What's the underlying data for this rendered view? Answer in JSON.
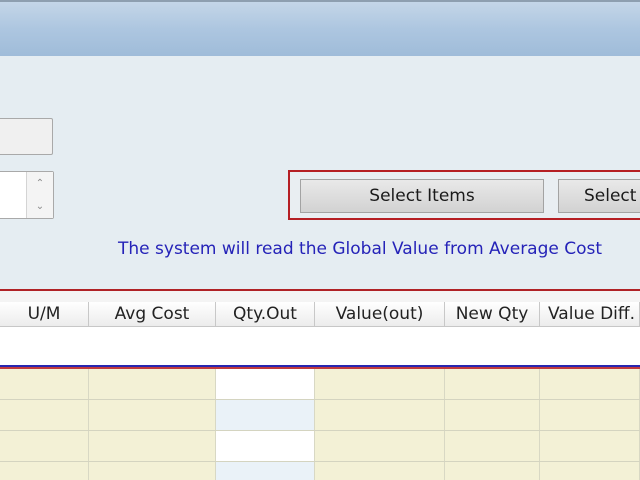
{
  "buttons": {
    "select_items": "Select Items",
    "select_second": "Select"
  },
  "info_text": "The system will read the Global Value from Average Cost",
  "spinner": {
    "up_icon": "chevron-up-icon",
    "down_icon": "chevron-down-icon"
  },
  "table": {
    "columns": [
      "U/M",
      "Avg Cost",
      "Qty.Out",
      "Value(out)",
      "New Qty",
      "Value Diff."
    ],
    "rows": [
      [
        "",
        "",
        "",
        "",
        "",
        ""
      ],
      [
        "",
        "",
        "",
        "",
        "",
        ""
      ],
      [
        "",
        "",
        "",
        "",
        "",
        ""
      ],
      [
        "",
        "",
        "",
        "",
        "",
        ""
      ]
    ]
  },
  "colors": {
    "highlight_border": "#b51f24",
    "info_text": "#2523b8",
    "grid_row": "#f3f1d6"
  }
}
